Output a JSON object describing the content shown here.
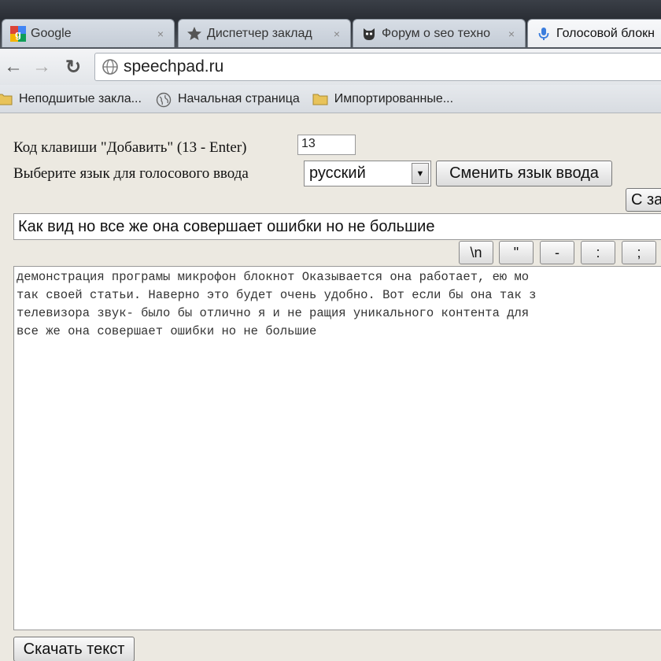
{
  "tabs": [
    {
      "label": "Google",
      "icon": "google-icon",
      "close": "×"
    },
    {
      "label": "Диспетчер заклад",
      "icon": "star-icon",
      "close": "×"
    },
    {
      "label": "Форум о seo техно",
      "icon": "forum-icon",
      "close": "×"
    },
    {
      "label": "Голосовой блокн",
      "icon": "microphone-icon",
      "close": ""
    }
  ],
  "toolbar": {
    "back": "←",
    "forward": "→",
    "reload": "↻",
    "url": "speechpad.ru"
  },
  "bookmarks": [
    {
      "label": "Неподшитые закла...",
      "icon": "folder-icon"
    },
    {
      "label": "Начальная страница",
      "icon": "globe-icon"
    },
    {
      "label": "Импортированные...",
      "icon": "folder-icon"
    }
  ],
  "page": {
    "key_code_label": "Код клавиши \"Добавить\" (13 - Enter)",
    "key_code_value": "13",
    "language_label": "Выберите язык для голосового ввода",
    "language_selected": "русский",
    "change_language_button": "Сменить язык ввода",
    "partial_button": "С за",
    "voice_input_value": "Как вид но все же она совершает ошибки но не большие",
    "small_buttons": [
      "\\n",
      "\"",
      "-",
      ":",
      ";"
    ],
    "text_area_content": "демонстрация програмы микрофон блокнот Оказывается она работает, ею мо\nтак своей статьи. Наверно это будет очень удобно. Вот если бы она так з\nтелевизора звук- было бы отлично я и не ращия уникального контента для \nвсе же она совершает ошибки но не большие",
    "download_button": "Скачать текст"
  },
  "colors": {
    "page_background": "#ece9e1",
    "tabstrip": "#2a2e35",
    "google_blue": "#4285f4",
    "google_red": "#db4437",
    "google_yellow": "#f4b400",
    "google_green": "#0f9d58",
    "mic_blue": "#3b7ddd",
    "folder_yellow": "#e8c35a"
  }
}
